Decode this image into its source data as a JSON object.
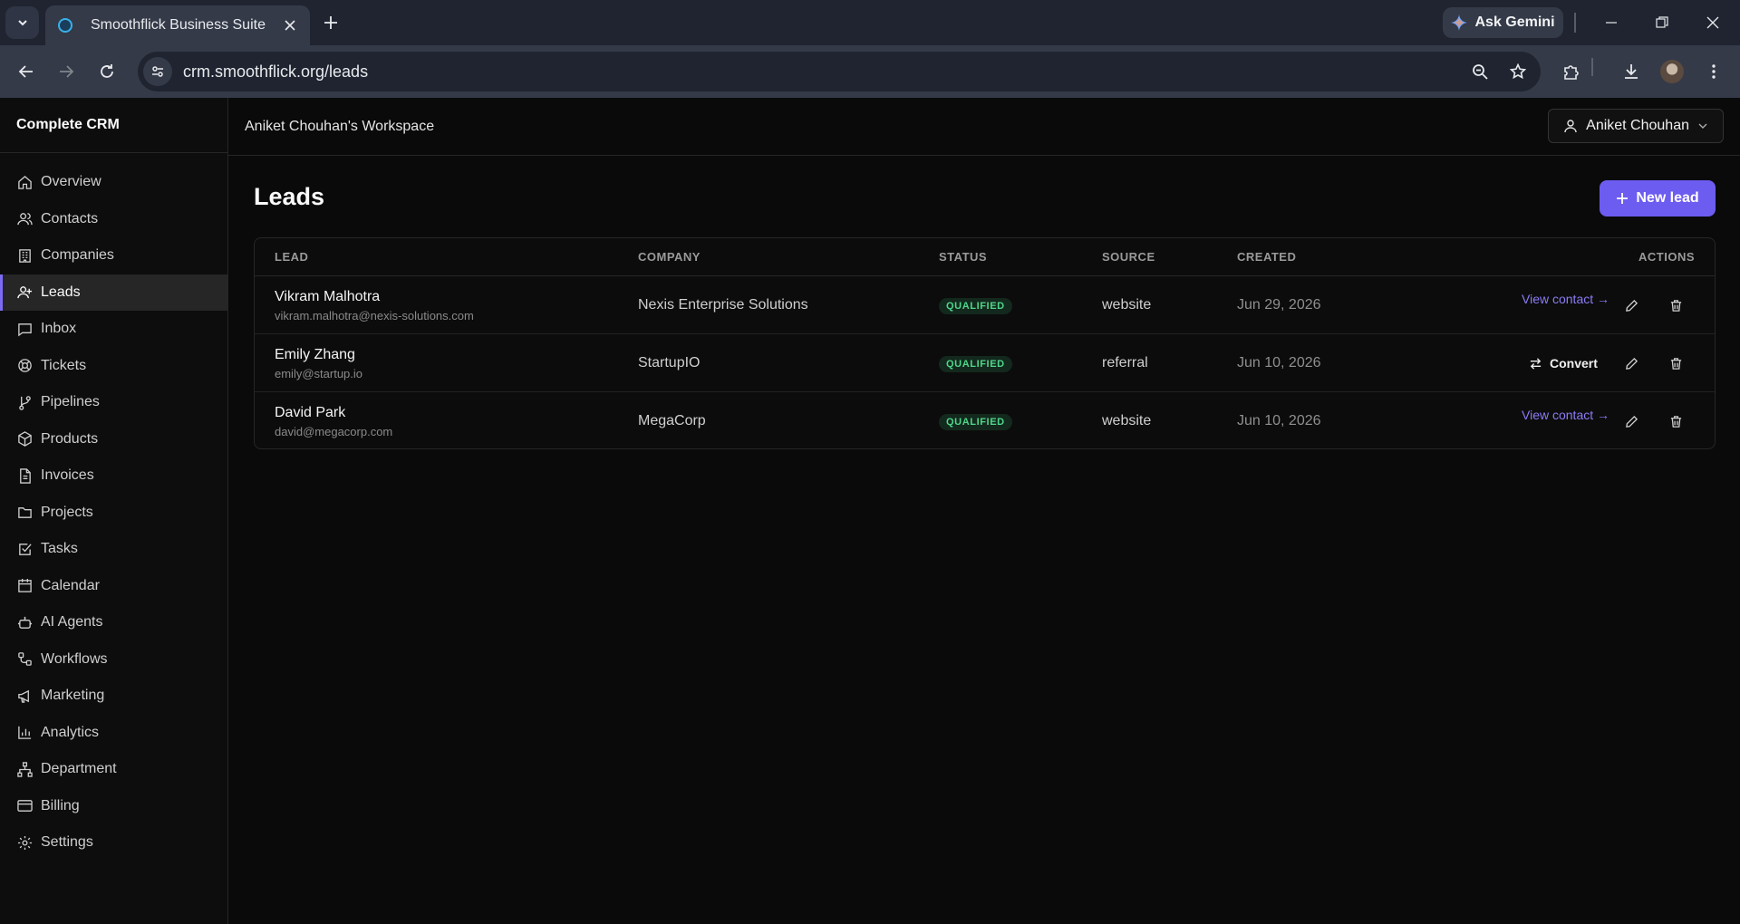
{
  "browser": {
    "tab_title": "Smoothflick Business Suite",
    "url": "crm.smoothflick.org/leads",
    "gemini_label": "Ask Gemini"
  },
  "sidebar": {
    "brand": "Complete CRM",
    "items": [
      {
        "label": "Overview",
        "icon": "home-icon"
      },
      {
        "label": "Contacts",
        "icon": "users-icon"
      },
      {
        "label": "Companies",
        "icon": "building-icon"
      },
      {
        "label": "Leads",
        "icon": "user-plus-icon",
        "active": true
      },
      {
        "label": "Inbox",
        "icon": "message-icon"
      },
      {
        "label": "Tickets",
        "icon": "lifebuoy-icon"
      },
      {
        "label": "Pipelines",
        "icon": "git-branch-icon"
      },
      {
        "label": "Products",
        "icon": "package-icon"
      },
      {
        "label": "Invoices",
        "icon": "file-text-icon"
      },
      {
        "label": "Projects",
        "icon": "folder-icon"
      },
      {
        "label": "Tasks",
        "icon": "check-square-icon"
      },
      {
        "label": "Calendar",
        "icon": "calendar-icon"
      },
      {
        "label": "AI Agents",
        "icon": "bot-icon"
      },
      {
        "label": "Workflows",
        "icon": "workflow-icon"
      },
      {
        "label": "Marketing",
        "icon": "megaphone-icon"
      },
      {
        "label": "Analytics",
        "icon": "bar-chart-icon"
      },
      {
        "label": "Department",
        "icon": "network-icon"
      },
      {
        "label": "Billing",
        "icon": "credit-card-icon"
      },
      {
        "label": "Settings",
        "icon": "gear-icon"
      }
    ]
  },
  "header": {
    "workspace": "Aniket Chouhan's Workspace",
    "user_name": "Aniket Chouhan"
  },
  "page": {
    "title": "Leads",
    "new_lead_label": "New lead"
  },
  "table": {
    "columns": {
      "lead": "LEAD",
      "company": "COMPANY",
      "status": "STATUS",
      "source": "SOURCE",
      "created": "CREATED",
      "actions": "ACTIONS"
    },
    "rows": [
      {
        "name": "Vikram Malhotra",
        "email": "vikram.malhotra@nexis-solutions.com",
        "company": "Nexis Enterprise Solutions",
        "status": "QUALIFIED",
        "source": "website",
        "created": "Jun 29, 2026",
        "action": "View contact →"
      },
      {
        "name": "Emily Zhang",
        "email": "emily@startup.io",
        "company": "StartupIO",
        "status": "QUALIFIED",
        "source": "referral",
        "created": "Jun 10, 2026",
        "action": "Convert"
      },
      {
        "name": "David Park",
        "email": "david@megacorp.com",
        "company": "MegaCorp",
        "status": "QUALIFIED",
        "source": "website",
        "created": "Jun 10, 2026",
        "action": "View contact →"
      }
    ]
  },
  "colors": {
    "accent": "#6d5cf0",
    "link": "#8b7cf6",
    "badge_text": "#4fd68a",
    "badge_bg": "#13291d"
  }
}
